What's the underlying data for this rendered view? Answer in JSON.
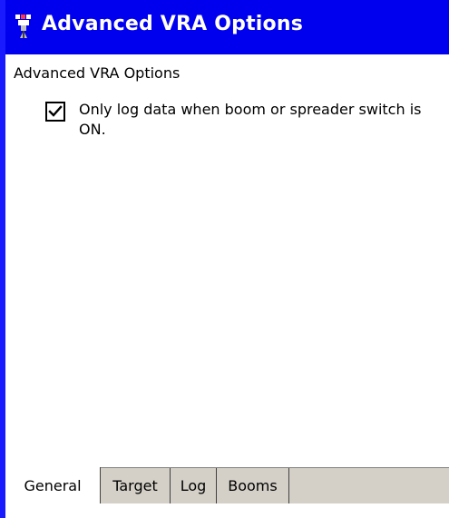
{
  "window": {
    "title": "Advanced VRA Options",
    "title_bar_color": "#0000ee",
    "app_icon": "vra-app-icon"
  },
  "content": {
    "section_label": "Advanced VRA Options",
    "option": {
      "label": "Only log data when boom or spreader switch is ON.",
      "checked": true
    }
  },
  "tabs": [
    {
      "label": "General",
      "active": true
    },
    {
      "label": "Target",
      "active": false
    },
    {
      "label": "Log",
      "active": false
    },
    {
      "label": "Booms",
      "active": false
    }
  ]
}
